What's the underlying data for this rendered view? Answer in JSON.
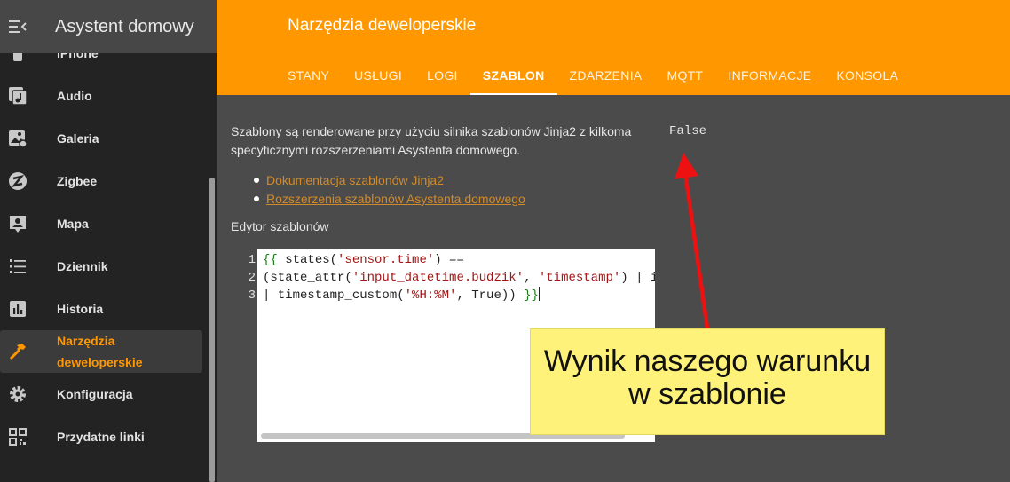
{
  "app": {
    "title": "Asystent domowy"
  },
  "sidebar": {
    "items": [
      {
        "label": "iPhone",
        "icon": "cellphone-icon"
      },
      {
        "label": "Audio",
        "icon": "music-note-icon"
      },
      {
        "label": "Galeria",
        "icon": "image-album-icon"
      },
      {
        "label": "Zigbee",
        "icon": "zigbee-icon"
      },
      {
        "label": "Mapa",
        "icon": "account-location-icon"
      },
      {
        "label": "Dziennik",
        "icon": "list-icon"
      },
      {
        "label": "Historia",
        "icon": "chart-box-icon"
      },
      {
        "label": "Narzędzia deweloperskie",
        "icon": "hammer-icon",
        "active": true
      },
      {
        "label": "Konfiguracja",
        "icon": "gear-icon"
      },
      {
        "label": "Przydatne linki",
        "icon": "qrcode-icon"
      }
    ]
  },
  "header": {
    "title": "Narzędzia deweloperskie",
    "tabs": [
      "STANY",
      "USŁUGI",
      "LOGI",
      "SZABLON",
      "ZDARZENIA",
      "MQTT",
      "INFORMACJE",
      "KONSOLA"
    ],
    "active_tab": "SZABLON"
  },
  "content": {
    "description": "Szablony są renderowane przy użyciu silnika szablonów Jinja2 z kilkoma specyficznymi rozszerzeniami Asystenta domowego.",
    "links": [
      "Dokumentacja szablonów Jinja2",
      "Rozszerzenia szablonów Asystenta domowego"
    ],
    "editor_label": "Edytor szablonów",
    "line_numbers": [
      "1",
      "2",
      "3"
    ],
    "result": "False"
  },
  "annotation": {
    "text": "Wynik naszego warunku w szablonie"
  },
  "colors": {
    "accent": "#ff9800",
    "sidebar_bg": "#232323",
    "content_bg": "#4b4b4b",
    "note_bg": "#fff27a",
    "arrow": "#ee1111"
  }
}
